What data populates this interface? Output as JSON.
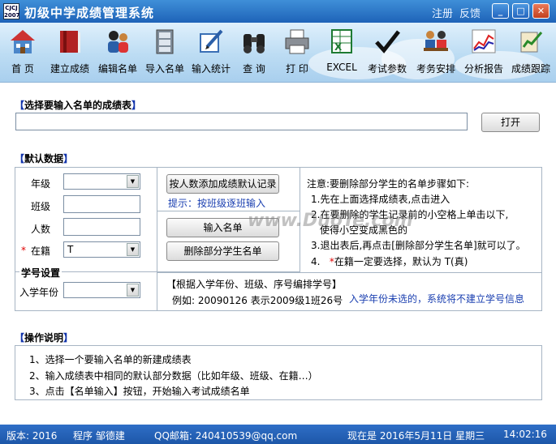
{
  "window": {
    "title": "初级中学成绩管理系统",
    "app_icon_text": "CJCJ 2007",
    "links": [
      "注册",
      "反馈"
    ],
    "min_glyph": "_",
    "max_glyph": "□",
    "close_glyph": "✕"
  },
  "toolbar": {
    "items": [
      {
        "label": "首 页",
        "icon": "house-icon"
      },
      {
        "label": "建立成绩",
        "icon": "book-icon"
      },
      {
        "label": "编辑名单",
        "icon": "people-icon"
      },
      {
        "label": "导入名单",
        "icon": "cabinet-icon"
      },
      {
        "label": "输入统计",
        "icon": "edit-icon"
      },
      {
        "label": "查 询",
        "icon": "binoculars-icon"
      },
      {
        "label": "打 印",
        "icon": "printer-icon"
      },
      {
        "label": "EXCEL",
        "icon": "excel-icon"
      },
      {
        "label": "考试参数",
        "icon": "checkmark-icon"
      },
      {
        "label": "考务安排",
        "icon": "meeting-icon"
      },
      {
        "label": "分析报告",
        "icon": "chart-icon"
      },
      {
        "label": "成绩跟踪",
        "icon": "tracking-icon"
      }
    ]
  },
  "select_table": {
    "title_open": "【",
    "title_text": "选择要输入名单的成绩表",
    "title_close": "】",
    "value": "",
    "open_button": "打开"
  },
  "defaults": {
    "title_open": "【",
    "title_text": "默认数据",
    "title_close": "】",
    "grade_label": "年级",
    "grade_value": "",
    "class_label": "班级",
    "class_value": "",
    "count_label": "人数",
    "count_value": "",
    "enrolled_star": "*",
    "enrolled_label": "在籍",
    "enrolled_value": "T",
    "student_id_section": "学号设置",
    "entry_year_label": "入学年份",
    "entry_year_value": "",
    "add_by_count_button": "按人数添加成绩默认记录",
    "hint": "提示：按班级逐班输入",
    "enter_list_button": "输入名单",
    "delete_partial_button": "删除部分学生名单",
    "note_title": "注意:要删除部分学生的名单步骤如下:",
    "note_steps": [
      "1.先在上面选择成绩表,点击进入",
      "2.在要删除的学生记录前的小空格上单击以下,",
      "使得小空变成黑色的",
      "3.退出表后,再点击[删除部分学生名单]就可以了。"
    ],
    "note_step4_prefix": "4.",
    "note_step4_star": "*",
    "note_step4_text": "在籍一定要选择，默认为 T(真)",
    "id_rule_title": "【根据入学年份、班级、序号编排学号】",
    "id_rule_example": "例如: 20090126 表示2009级1班26号",
    "id_rule_warning": "入学年份未选的，系统将不建立学号信息"
  },
  "operations": {
    "title_open": "【",
    "title_text": "操作说明",
    "title_close": "】",
    "lines": [
      "1、选择一个要输入名单的新建成绩表",
      "2、输入成绩表中相同的默认部分数据（比如年级、班级、在籍…）",
      "3、点击【名单输入】按钮，开始输入考试成绩名单"
    ]
  },
  "watermark": "www.DuoTe.com",
  "status": {
    "version": "版本: 2016",
    "programmer": "程序  邹德建",
    "email": "QQ邮箱: 240410539@qq.com",
    "now": "现在是  2016年5月11日  星期三",
    "time": "14:02:16"
  }
}
